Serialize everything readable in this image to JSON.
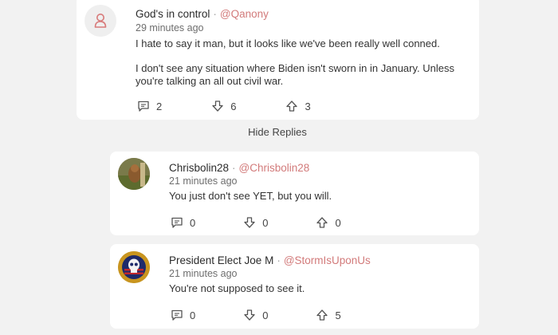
{
  "comment": {
    "author": "God's in control",
    "handle": "@Qanony",
    "time": "29 minutes ago",
    "paragraph1": "I hate to say it man, but it looks like we've been really well conned.",
    "paragraph2": "I don't see any situation where Biden isn't sworn in in January. Unless you're talking an all out civil war.",
    "replies_count": "2",
    "downvotes": "6",
    "upvotes": "3",
    "avatar_icon": "user-icon"
  },
  "hide_replies_label": "Hide Replies",
  "replies": [
    {
      "author": "Chrisbolin28",
      "handle": "@Chrisbolin28",
      "time": "21 minutes ago",
      "text": "You just don't see YET, but you will.",
      "replies_count": "0",
      "downvotes": "0",
      "upvotes": "0"
    },
    {
      "author": "President Elect Joe M",
      "handle": "@StormIsUponUs",
      "time": "21 minutes ago",
      "text": "You're not supposed to see it.",
      "replies_count": "0",
      "downvotes": "0",
      "upvotes": "5"
    }
  ],
  "colors": {
    "handle": "#d27a7a",
    "background": "#f2f2f2",
    "card": "#ffffff"
  }
}
